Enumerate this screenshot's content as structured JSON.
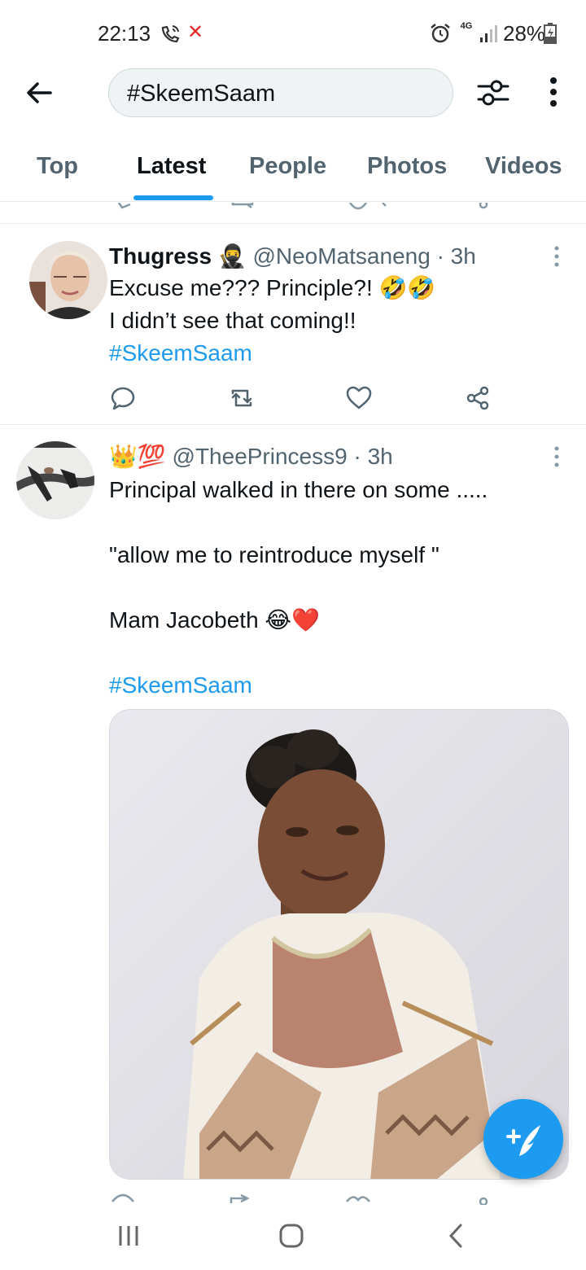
{
  "status_bar": {
    "time": "22:13",
    "network": "4G",
    "battery": "28%"
  },
  "header": {
    "search_query": "#SkeemSaam"
  },
  "tabs": [
    {
      "label": "Top",
      "active": false
    },
    {
      "label": "Latest",
      "active": true
    },
    {
      "label": "People",
      "active": false
    },
    {
      "label": "Photos",
      "active": false
    },
    {
      "label": "Videos",
      "active": false
    }
  ],
  "tweets": [
    {
      "name": "Thugress",
      "name_emoji": "🥷",
      "handle": "@NeoMatsaneng",
      "time": "· 3h",
      "lines": [
        "Excuse me??? Principle?! 🤣🤣",
        "I didn’t see that coming!!"
      ],
      "hashtag": "#SkeemSaam"
    },
    {
      "name_emoji": "👑💯",
      "handle": "@TheePrincess9",
      "time": "· 3h",
      "lines": [
        "Principal walked in there on some .....",
        "\"allow me to reintroduce myself \"",
        "Mam Jacobeth 😂❤️"
      ],
      "hashtag": "#SkeemSaam"
    }
  ],
  "colors": {
    "accent": "#1d9bf0",
    "text_primary": "#0f1419",
    "text_secondary": "#536471"
  }
}
